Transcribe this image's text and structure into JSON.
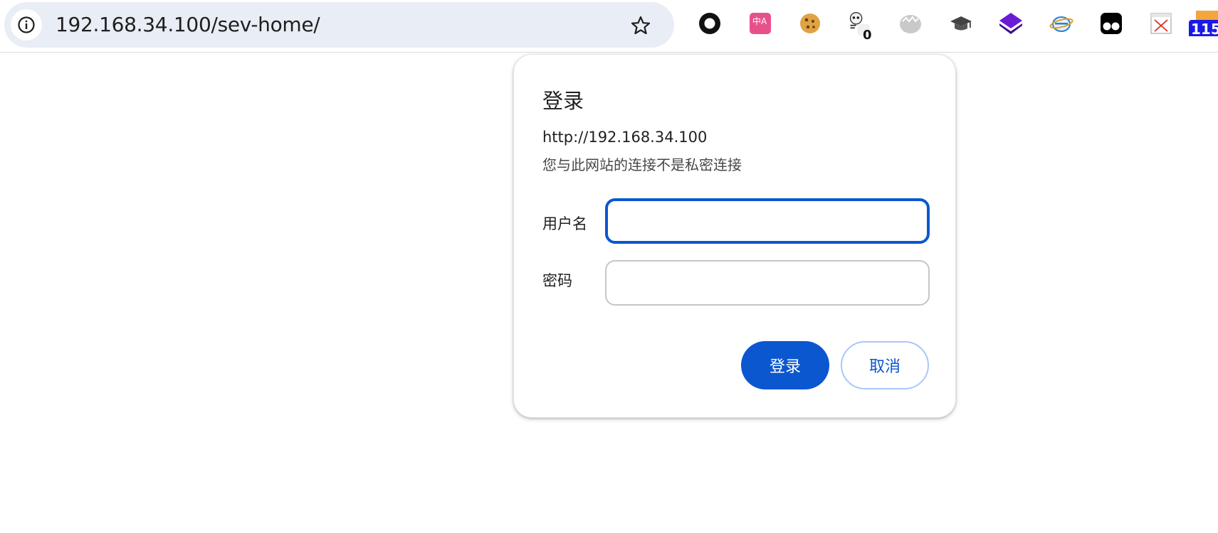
{
  "browser": {
    "url": "192.168.34.100/sev-home/",
    "extensions": [
      {
        "name": "circle-extension-icon"
      },
      {
        "name": "translate-extension-icon",
        "text": "中A"
      },
      {
        "name": "cookie-extension-icon"
      },
      {
        "name": "panda-extension-icon",
        "badge": "0"
      },
      {
        "name": "egg-extension-icon"
      },
      {
        "name": "graduation-cap-extension-icon"
      },
      {
        "name": "layers-extension-icon"
      },
      {
        "name": "ie-extension-icon"
      },
      {
        "name": "tampermonkey-extension-icon"
      },
      {
        "name": "broken-image-extension-icon"
      },
      {
        "name": "rss-extension-icon",
        "badge": "115"
      }
    ]
  },
  "dialog": {
    "title": "登录",
    "origin": "http://192.168.34.100",
    "warning": "您与此网站的连接不是私密连接",
    "username_label": "用户名",
    "password_label": "密码",
    "username_value": "",
    "password_value": "",
    "login_label": "登录",
    "cancel_label": "取消"
  },
  "colors": {
    "primary": "#0b57d0",
    "omnibox_bg": "#e9edf5"
  }
}
